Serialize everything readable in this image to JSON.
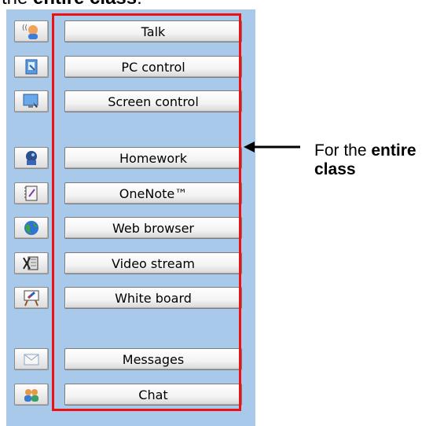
{
  "caption": {
    "prefix": "the ",
    "bold": "entire class",
    "suffix": ":"
  },
  "annotation": {
    "prefix": "For the ",
    "bold_line1": "entire",
    "bold_line2": "class"
  },
  "buttons": [
    {
      "label": "Talk",
      "icon": "talk-icon"
    },
    {
      "label": "PC control",
      "icon": "pc-control-icon"
    },
    {
      "label": "Screen control",
      "icon": "screen-control-icon"
    },
    {
      "label": "Homework",
      "icon": "homework-icon"
    },
    {
      "label": "OneNote™",
      "icon": "onenote-icon"
    },
    {
      "label": "Web browser",
      "icon": "web-browser-icon"
    },
    {
      "label": "Video stream",
      "icon": "video-stream-icon"
    },
    {
      "label": "White board",
      "icon": "white-board-icon"
    },
    {
      "label": "Messages",
      "icon": "messages-icon"
    },
    {
      "label": "Chat",
      "icon": "chat-icon"
    }
  ],
  "colors": {
    "panel": "#a9c9ea",
    "highlight": "#ee1111"
  }
}
